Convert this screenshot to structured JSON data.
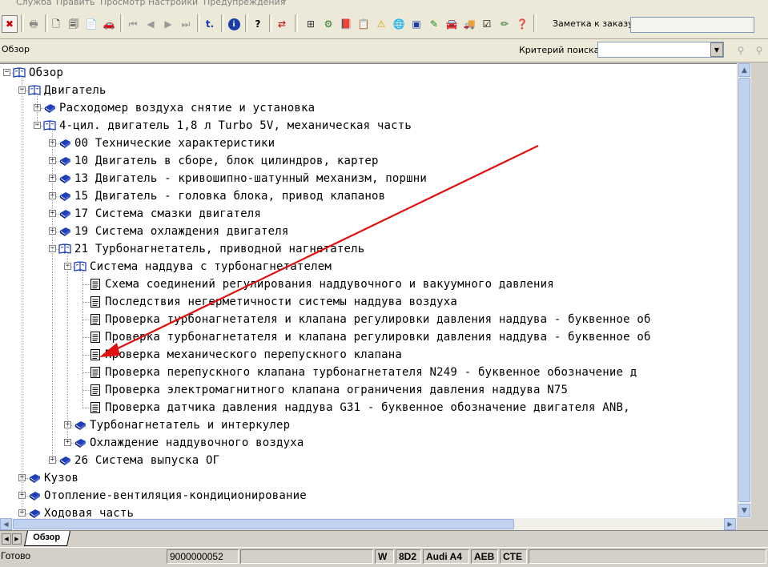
{
  "menu": [
    "Служба",
    "Править",
    "Просмотр",
    "Настройки",
    "Предупреждения",
    "?"
  ],
  "order_note": {
    "label": "Заметка к заказу:",
    "value": ""
  },
  "panel_title": "Обзор",
  "search": {
    "label": "Критерий поиска:",
    "value": ""
  },
  "tree": [
    {
      "text": "Обзор",
      "level": 0,
      "toggle": "-",
      "icon": "book-open"
    },
    {
      "text": "Двигатель",
      "level": 1,
      "toggle": "-",
      "icon": "book-open"
    },
    {
      "text": "Расходомер воздуха снятие и установка",
      "level": 2,
      "toggle": "+",
      "icon": "book-closed"
    },
    {
      "text": "4-цил. двигатель 1,8 л Turbo 5V, механическая часть",
      "level": 2,
      "toggle": "-",
      "icon": "book-open"
    },
    {
      "text": "00 Технические характеристики",
      "level": 3,
      "toggle": "+",
      "icon": "book-closed"
    },
    {
      "text": "10 Двигатель в сборе, блок цилиндров, картер",
      "level": 3,
      "toggle": "+",
      "icon": "book-closed"
    },
    {
      "text": "13 Двигатель - кривошипно-шатунный механизм, поршни",
      "level": 3,
      "toggle": "+",
      "icon": "book-closed"
    },
    {
      "text": "15 Двигатель - головка блока, привод клапанов",
      "level": 3,
      "toggle": "+",
      "icon": "book-closed"
    },
    {
      "text": "17 Система смазки двигателя",
      "level": 3,
      "toggle": "+",
      "icon": "book-closed"
    },
    {
      "text": "19 Система охлаждения двигателя",
      "level": 3,
      "toggle": "+",
      "icon": "book-closed"
    },
    {
      "text": "21 Турбонагнетатель, приводной нагнетатель",
      "level": 3,
      "toggle": "-",
      "icon": "book-open"
    },
    {
      "text": "Система наддува с турбонагнетателем",
      "level": 4,
      "toggle": "-",
      "icon": "book-open"
    },
    {
      "text": "Схема соединений регулирования наддувочного и вакуумного давления",
      "level": 5,
      "toggle": "",
      "icon": "doc"
    },
    {
      "text": "Последствия негерметичности системы наддува воздуха",
      "level": 5,
      "toggle": "",
      "icon": "doc"
    },
    {
      "text": "Проверка турбонагнетателя и клапана регулировки давления наддува - буквенное об",
      "level": 5,
      "toggle": "",
      "icon": "doc"
    },
    {
      "text": "Проверка турбонагнетателя и клапана регулировки давления наддува - буквенное об",
      "level": 5,
      "toggle": "",
      "icon": "doc"
    },
    {
      "text": "Проверка механического перепускного клапана",
      "level": 5,
      "toggle": "",
      "icon": "doc"
    },
    {
      "text": "Проверка  перепускного клапана турбонагнетателя N249  - буквенное обозначение д",
      "level": 5,
      "toggle": "",
      "icon": "doc"
    },
    {
      "text": "Проверка  электромагнитного клапана ограничения давления наддува N75",
      "level": 5,
      "toggle": "",
      "icon": "doc"
    },
    {
      "text": "Проверка  датчика давления наддува G31  - буквенное обозначение двигателя ANB,",
      "level": 5,
      "toggle": "",
      "icon": "doc"
    },
    {
      "text": "Турбонагнетатель и интеркулер",
      "level": 4,
      "toggle": "+",
      "icon": "book-closed"
    },
    {
      "text": "Охлаждение наддувочного воздуха",
      "level": 4,
      "toggle": "+",
      "icon": "book-closed"
    },
    {
      "text": "26 Система выпуска ОГ",
      "level": 3,
      "toggle": "+",
      "icon": "book-closed"
    },
    {
      "text": "Кузов",
      "level": 1,
      "toggle": "+",
      "icon": "book-closed"
    },
    {
      "text": "Отопление-вентиляция-кондиционирование",
      "level": 1,
      "toggle": "+",
      "icon": "book-closed"
    },
    {
      "text": "Ходовая часть",
      "level": 1,
      "toggle": "+",
      "icon": "book-closed"
    }
  ],
  "tabs": [
    "Обзор"
  ],
  "status": {
    "ready": "Готово",
    "order_number": "9000000052",
    "field_w": "W",
    "code": "8D2",
    "model": "Audi A4",
    "engine": "AEB",
    "transmission": "CTE"
  },
  "colors": {
    "annotation_arrow": "#e01010",
    "scroll_blue": "#c1d2ee",
    "book_blue": "#1f3fb8"
  }
}
